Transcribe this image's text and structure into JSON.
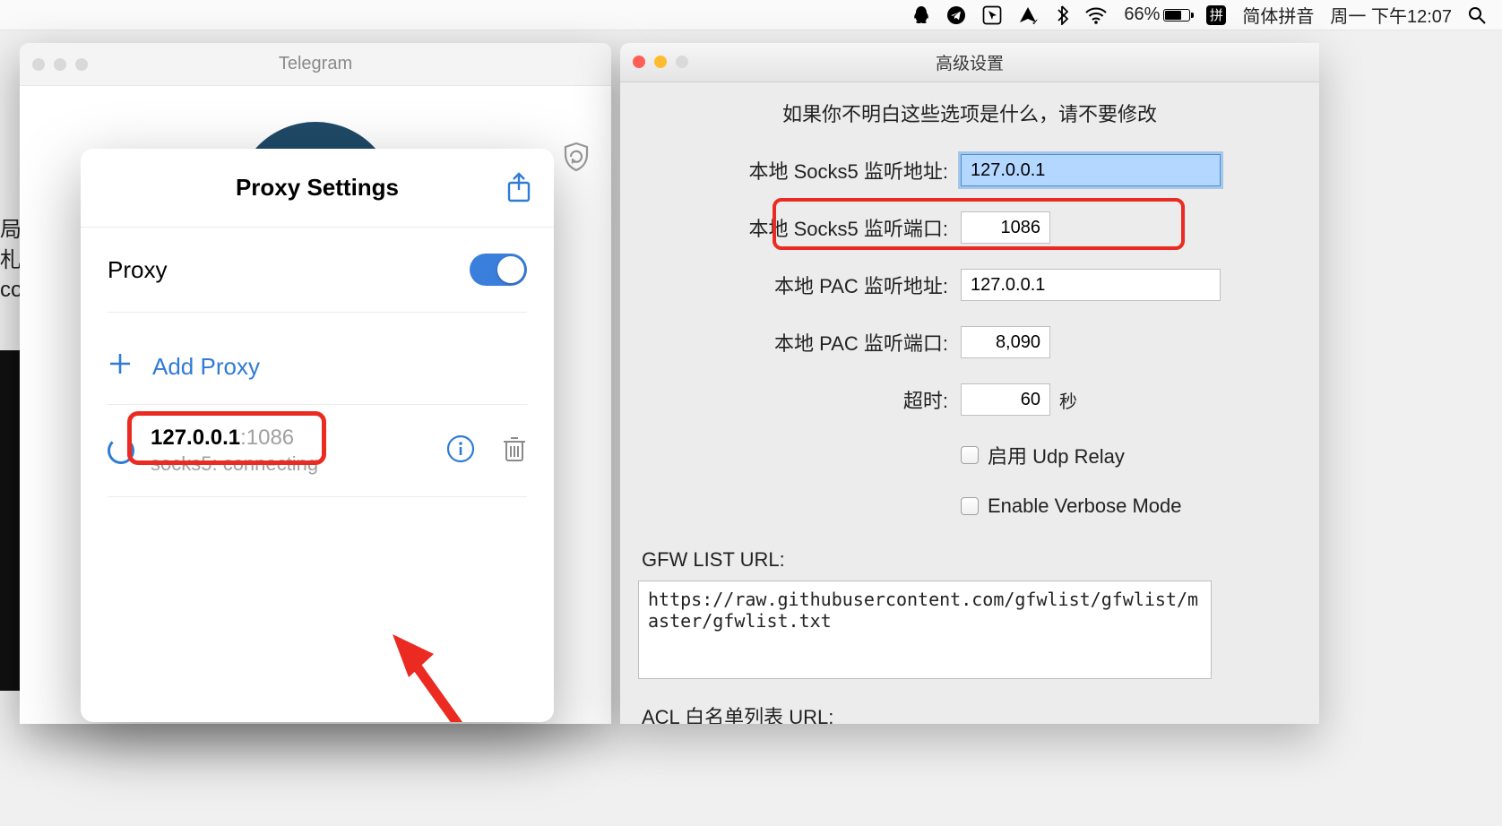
{
  "menubar": {
    "battery_pct": "66%",
    "input_method_badge": "拼",
    "input_method_text": "简体拼音",
    "clock": "周一 下午12:07"
  },
  "bg_left": {
    "l1": "局札",
    "l2": "co"
  },
  "telegram": {
    "title": "Telegram"
  },
  "proxy": {
    "title": "Proxy Settings",
    "label": "Proxy",
    "add_label": "Add Proxy",
    "entry": {
      "ip": "127.0.0.1",
      "port": ":1086",
      "status": "socks5: connecting"
    }
  },
  "adv": {
    "title": "高级设置",
    "warning": "如果你不明白这些选项是什么，请不要修改",
    "socks_addr_label": "本地 Socks5 监听地址:",
    "socks_addr_value": "127.0.0.1",
    "socks_port_label": "本地 Socks5 监听端口:",
    "socks_port_value": "1086",
    "pac_addr_label": "本地 PAC 监听地址:",
    "pac_addr_value": "127.0.0.1",
    "pac_port_label": "本地 PAC 监听端口:",
    "pac_port_value": "8,090",
    "timeout_label": "超时:",
    "timeout_value": "60",
    "timeout_suffix": "秒",
    "udp_label": "启用 Udp Relay",
    "verbose_label": "Enable Verbose Mode",
    "gfw_label": "GFW LIST URL:",
    "gfw_value": "https://raw.githubusercontent.com/gfwlist/gfwlist/master/gfwlist.txt",
    "acl_label": "ACL 白名单列表 URL:"
  }
}
